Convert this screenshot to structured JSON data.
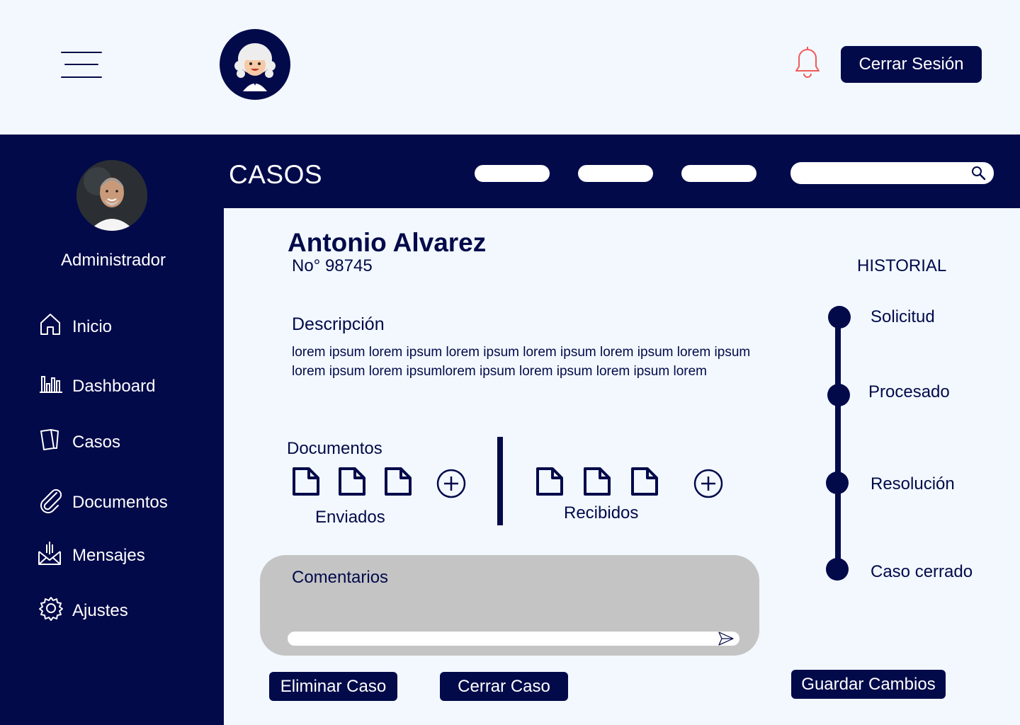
{
  "header": {
    "menu_icon": "hamburger-menu-icon",
    "logo": "judge-wig-logo",
    "notification_icon": "bell-icon",
    "logout_label": "Cerrar Sesión",
    "colors": {
      "primary": "#020A4A",
      "background": "#F2F8FE",
      "bell": "#F25A5A"
    }
  },
  "sidebar": {
    "role": "Administrador",
    "items": [
      {
        "label": "Inicio",
        "icon": "home-icon"
      },
      {
        "label": "Dashboard",
        "icon": "bar-chart-icon"
      },
      {
        "label": "Casos",
        "icon": "cards-icon"
      },
      {
        "label": "Documentos",
        "icon": "paperclip-icon"
      },
      {
        "label": "Mensajes",
        "icon": "mail-icon"
      },
      {
        "label": "Ajustes",
        "icon": "gear-icon"
      }
    ]
  },
  "cases_bar": {
    "title": "CASOS",
    "search_placeholder": "",
    "search_icon": "search-icon"
  },
  "case": {
    "client_name": "Antonio Alvarez",
    "number": "No° 98745",
    "description_title": "Descripción",
    "description": "lorem ipsum lorem ipsum lorem ipsum lorem ipsum lorem ipsum lorem ipsum lorem ipsum lorem ipsumlorem ipsum lorem ipsum lorem ipsum lorem",
    "documents_title": "Documentos",
    "sent_label": "Enviados",
    "received_label": "Recibidos",
    "comments_title": "Comentarios",
    "comment_placeholder": "",
    "buttons": {
      "delete": "Eliminar Caso",
      "close": "Cerrar Caso",
      "save": "Guardar Cambios"
    }
  },
  "history": {
    "title": "HISTORIAL",
    "steps": [
      "Solicitud",
      "Procesado",
      "Resolución",
      "Caso cerrado"
    ]
  }
}
